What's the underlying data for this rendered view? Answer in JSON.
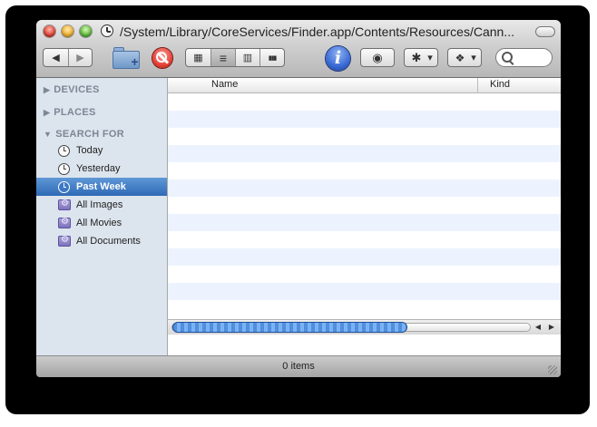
{
  "window": {
    "title": "/System/Library/CoreServices/Finder.app/Contents/Resources/Cann..."
  },
  "toolbar": {
    "back_glyph": "◀",
    "forward_glyph": "▶",
    "view_glyphs": [
      "▦",
      "≡",
      "▥",
      "▮▮▮"
    ],
    "active_view_index": 1,
    "info_glyph": "i",
    "eye_glyph": "◉",
    "gear_glyph": "✱",
    "dropdown_glyph": "▾",
    "dropbox_glyph": "❖",
    "search_placeholder": ""
  },
  "sidebar": {
    "sections": [
      {
        "label": "DEVICES",
        "expanded": false
      },
      {
        "label": "PLACES",
        "expanded": false
      },
      {
        "label": "SEARCH FOR",
        "expanded": true
      }
    ],
    "search_items": [
      {
        "label": "Today",
        "icon": "clock-icon"
      },
      {
        "label": "Yesterday",
        "icon": "clock-icon"
      },
      {
        "label": "Past Week",
        "icon": "clock-icon",
        "selected": true
      },
      {
        "label": "All Images",
        "icon": "smart-folder-icon"
      },
      {
        "label": "All Movies",
        "icon": "smart-folder-icon"
      },
      {
        "label": "All Documents",
        "icon": "smart-folder-icon"
      }
    ]
  },
  "list": {
    "columns": [
      "Name",
      "Kind"
    ],
    "scroll_left": "◀",
    "scroll_right": "▶"
  },
  "status": {
    "text": "0 items"
  },
  "colors": {
    "selection": "#2e69b6",
    "row_alt": "#edf3fe",
    "sidebar_bg": "#dce4ed"
  }
}
